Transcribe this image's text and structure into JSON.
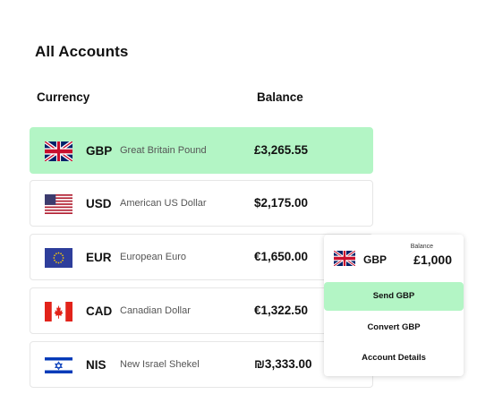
{
  "page": {
    "title": "All Accounts"
  },
  "table": {
    "headers": {
      "currency": "Currency",
      "balance": "Balance"
    },
    "rows": [
      {
        "flag": "uk-flag-icon",
        "code": "GBP",
        "name": "Great Britain Pound",
        "balance": "£3,265.55",
        "selected": true
      },
      {
        "flag": "us-flag-icon",
        "code": "USD",
        "name": "American US Dollar",
        "balance": "$2,175.00",
        "selected": false
      },
      {
        "flag": "eu-flag-icon",
        "code": "EUR",
        "name": "European Euro",
        "balance": "€1,650.00",
        "selected": false
      },
      {
        "flag": "canada-flag-icon",
        "code": "CAD",
        "name": "Canadian Dollar",
        "balance": "€1,322.50",
        "selected": false
      },
      {
        "flag": "israel-flag-icon",
        "code": "NIS",
        "name": "New Israel Shekel",
        "balance": "₪3,333.00",
        "selected": false
      }
    ]
  },
  "popup": {
    "flag": "uk-flag-icon",
    "code": "GBP",
    "balance_label": "Balance",
    "balance": "£1,000",
    "actions": [
      {
        "label": "Send GBP",
        "active": true
      },
      {
        "label": "Convert GBP",
        "active": false
      },
      {
        "label": "Account Details",
        "active": false
      }
    ]
  },
  "colors": {
    "selected_row": "#b3f5c5",
    "row_border": "#e6e6e6",
    "text": "#111111"
  }
}
